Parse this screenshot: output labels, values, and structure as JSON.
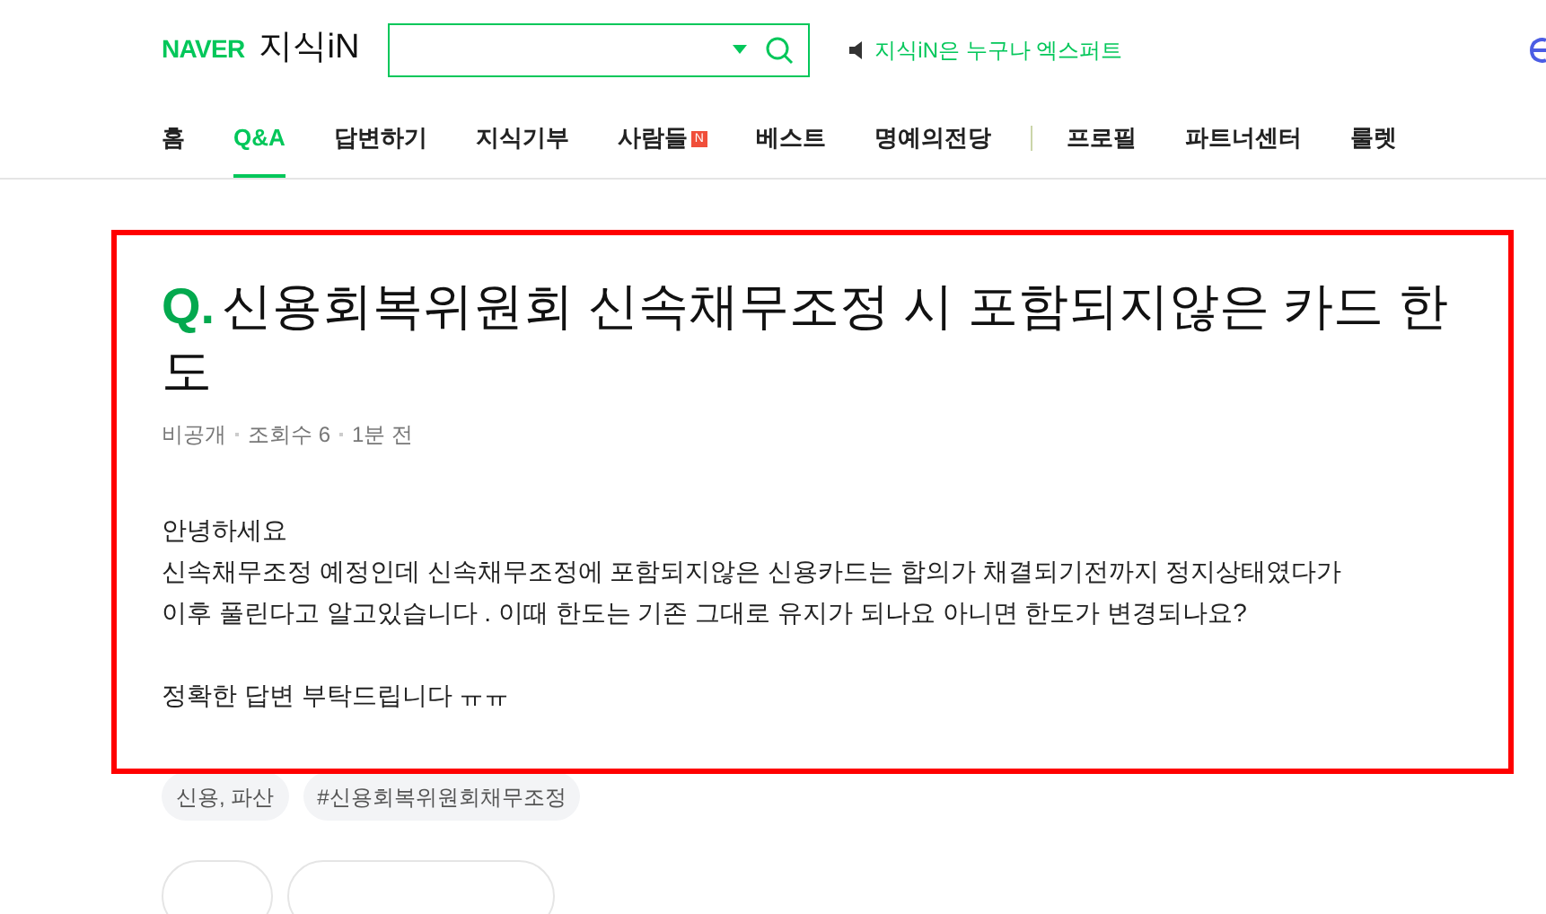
{
  "header": {
    "brand": "NAVER",
    "service": "지식iN",
    "notice": "지식iN은 누구나 엑스퍼트"
  },
  "nav": [
    {
      "label": "홈",
      "selected": false
    },
    {
      "label": "Q&A",
      "selected": true
    },
    {
      "label": "답변하기",
      "selected": false
    },
    {
      "label": "지식기부",
      "selected": false
    },
    {
      "label": "사람들",
      "selected": false,
      "badge": "N"
    },
    {
      "label": "베스트",
      "selected": false
    },
    {
      "label": "명예의전당",
      "selected": false
    },
    {
      "label": "프로필",
      "selected": false,
      "kind": "after_divider"
    },
    {
      "label": "파트너센터",
      "selected": false
    },
    {
      "label": "룰렛",
      "selected": false
    }
  ],
  "question": {
    "mark": "Q.",
    "title": "신용회복위원회 신속채무조정 시 포함되지않은 카드 한도",
    "meta": [
      "비공개",
      "조회수 6",
      "1분 전"
    ],
    "body": [
      "안녕하세요",
      "신속채무조정 예정인데 신속채무조정에 포함되지않은 신용카드는 합의가 채결되기전까지 정지상태였다가",
      "이후 풀린다고 알고있습니다 . 이때 한도는 기존 그대로 유지가 되나요 아니면 한도가 변경되나요?",
      "정확한 답변 부탁드립니다 ㅠㅠ"
    ]
  },
  "tags": [
    "신용, 파산",
    "#신용회복위원회채무조정"
  ]
}
